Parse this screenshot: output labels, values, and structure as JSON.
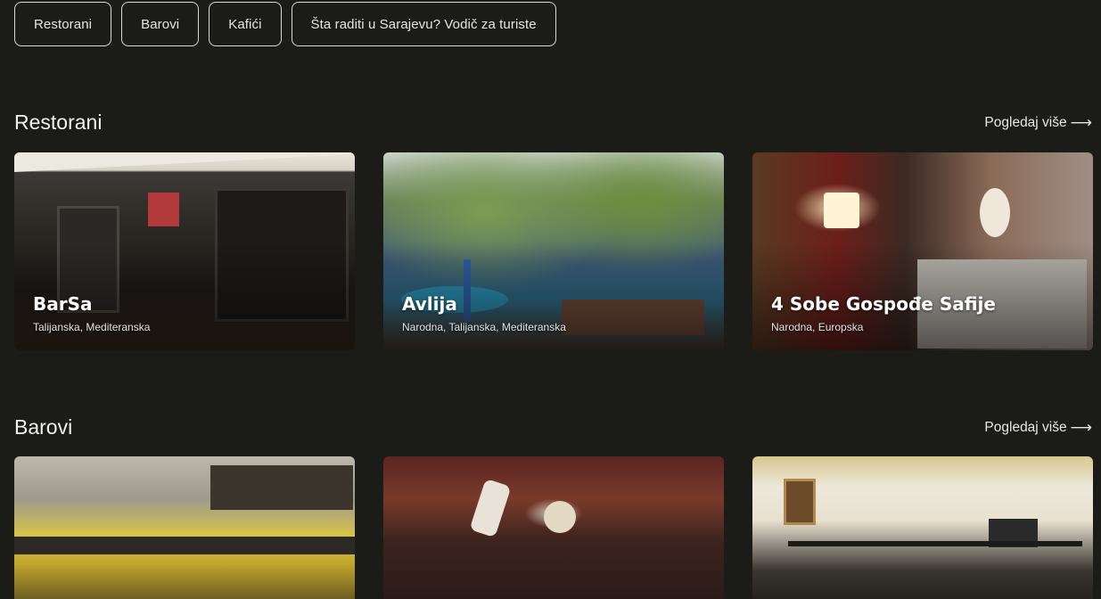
{
  "filters": [
    "Restorani",
    "Barovi",
    "Kafići",
    "Šta raditi u Sarajevu? Vodič za turiste"
  ],
  "sections": [
    {
      "title": "Restorani",
      "more_label": "Pogledaj više",
      "more_icon": "arrow-right-icon",
      "cards": [
        {
          "name": "BarSa",
          "tags": "Talijanska, Mediteranska"
        },
        {
          "name": "Avlija",
          "tags": "Narodna, Talijanska, Mediteranska"
        },
        {
          "name": "4 Sobe Gospođe Safije",
          "tags": "Narodna, Europska"
        }
      ]
    },
    {
      "title": "Barovi",
      "more_label": "Pogledaj više",
      "more_icon": "arrow-right-icon",
      "cards": [
        {
          "name": "",
          "tags": ""
        },
        {
          "name": "",
          "tags": ""
        },
        {
          "name": "",
          "tags": ""
        }
      ]
    }
  ],
  "colors": {
    "background": "#1b1c17",
    "chip_border": "#d9d9d4",
    "text": "#ffffff"
  }
}
